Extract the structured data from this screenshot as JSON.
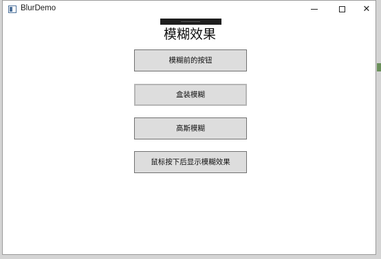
{
  "window": {
    "title": "BlurDemo",
    "controls": {
      "minimize_icon": "minimize-icon",
      "maximize_icon": "maximize-icon",
      "close_glyph": "✕"
    }
  },
  "main": {
    "heading": "模糊效果",
    "buttons": [
      {
        "label": "模糊前的按钮"
      },
      {
        "label": "盒装模糊"
      },
      {
        "label": "高斯模糊"
      },
      {
        "label": "鼠标按下后显示模糊效果"
      }
    ]
  },
  "colors": {
    "button_bg": "#dddddd",
    "button_border": "#707070",
    "window_bg": "#ffffff"
  }
}
